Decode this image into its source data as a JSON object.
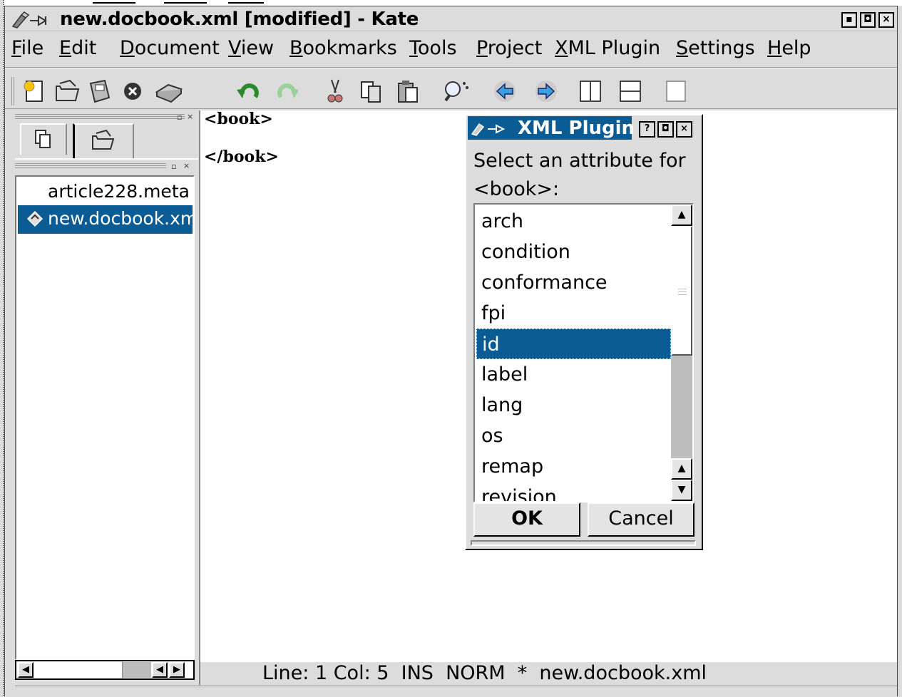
{
  "window": {
    "title": "new.docbook.xml [modified] - Kate",
    "buttons": [
      "minimize",
      "maximize",
      "close"
    ]
  },
  "menubar": [
    {
      "label": "File",
      "mnemonic": "F"
    },
    {
      "label": "Edit",
      "mnemonic": "E"
    },
    {
      "label": "Document",
      "mnemonic": "D"
    },
    {
      "label": "View",
      "mnemonic": "V"
    },
    {
      "label": "Bookmarks",
      "mnemonic": "B"
    },
    {
      "label": "Tools",
      "mnemonic": "T"
    },
    {
      "label": "Project",
      "mnemonic": "P"
    },
    {
      "label": "XML Plugin",
      "mnemonic": "X"
    },
    {
      "label": "Settings",
      "mnemonic": "S"
    },
    {
      "label": "Help",
      "mnemonic": "H"
    }
  ],
  "toolbar": {
    "icons": [
      "new-document-icon",
      "open-folder-icon",
      "save-icon",
      "close-document-icon",
      "print-icon",
      "undo-icon",
      "redo-icon",
      "cut-icon",
      "copy-icon",
      "paste-icon",
      "find-icon",
      "back-icon",
      "forward-icon",
      "split-vertical-icon",
      "split-horizontal-icon",
      "blank-page-icon"
    ]
  },
  "sidebar": {
    "tabs": [
      "document-list-tab",
      "file-selector-tab"
    ],
    "files": [
      {
        "name": "article228.meta",
        "selected": false,
        "modified": false
      },
      {
        "name": "new.docbook.xml",
        "selected": true,
        "modified": true
      }
    ]
  },
  "editor": {
    "lines": [
      "<book>",
      "",
      "</book>"
    ]
  },
  "statusbar": {
    "text": "Line: 1 Col: 5  INS  NORM  *  new.docbook.xml"
  },
  "dialog": {
    "title": "XML Plugin",
    "prompt": "Select an attribute for <book>:",
    "attributes": [
      "arch",
      "condition",
      "conformance",
      "fpi",
      "id",
      "label",
      "lang",
      "os",
      "remap",
      "revision"
    ],
    "selected_attribute": "id",
    "ok_label": "OK",
    "cancel_label": "Cancel"
  }
}
